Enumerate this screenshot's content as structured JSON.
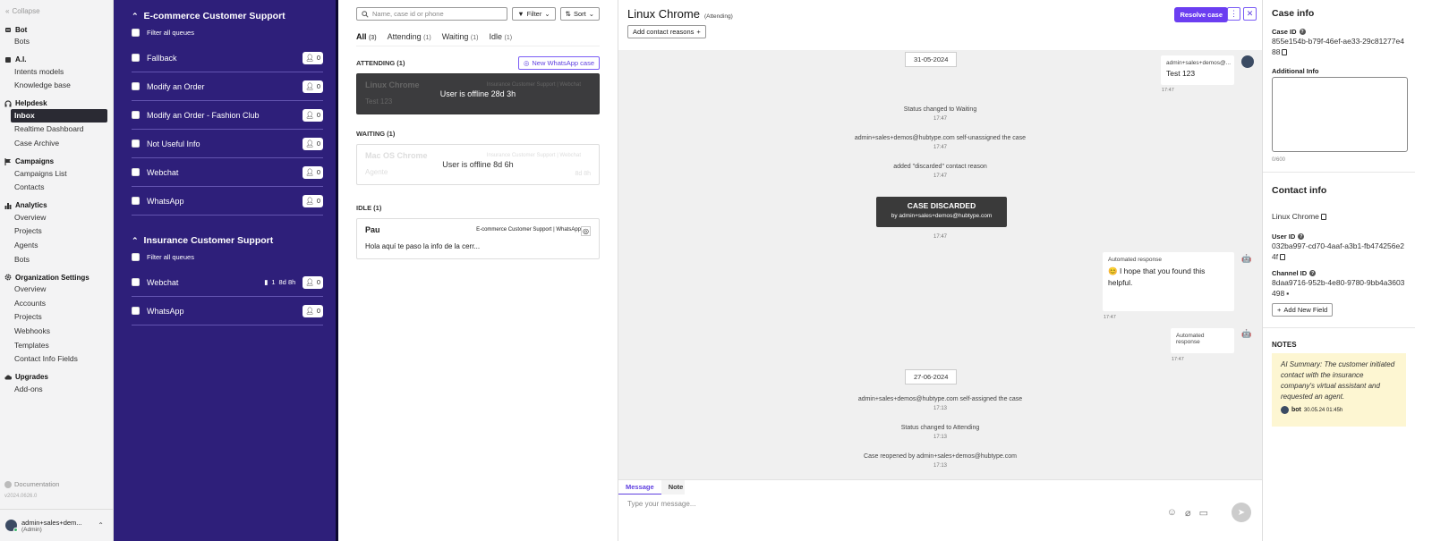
{
  "nav": {
    "collapse": "Collapse",
    "groups": [
      {
        "title": "Bot",
        "icon": "robot-icon",
        "items": [
          "Bots"
        ]
      },
      {
        "title": "A.I.",
        "icon": "ai-icon",
        "items": [
          "Intents models",
          "Knowledge base"
        ]
      },
      {
        "title": "Helpdesk",
        "icon": "headset-icon",
        "items": [
          "Inbox",
          "Realtime Dashboard",
          "Case Archive"
        ]
      },
      {
        "title": "Campaigns",
        "icon": "flag-icon",
        "items": [
          "Campaigns List",
          "Contacts"
        ]
      },
      {
        "title": "Analytics",
        "icon": "bar-chart-icon",
        "items": [
          "Overview",
          "Projects",
          "Agents",
          "Bots"
        ]
      },
      {
        "title": "Organization Settings",
        "icon": "gear-icon",
        "items": [
          "Overview",
          "Accounts",
          "Projects",
          "Webhooks",
          "Templates",
          "Contact Info Fields"
        ]
      },
      {
        "title": "Upgrades",
        "icon": "cloud-icon",
        "items": [
          "Add-ons"
        ]
      }
    ],
    "active_item": "Inbox",
    "documentation": "Documentation",
    "version": "v2024.0626.0",
    "user": {
      "name": "admin+sales+dem...",
      "role": "(Admin)"
    }
  },
  "queues": {
    "sections": [
      {
        "title": "E-commerce Customer Support",
        "filter_label": "Filter all queues",
        "rows": [
          {
            "name": "Fallback",
            "count": "0"
          },
          {
            "name": "Modify an Order",
            "count": "0"
          },
          {
            "name": "Modify an Order - Fashion Club",
            "count": "0"
          },
          {
            "name": "Not Useful Info",
            "count": "0"
          },
          {
            "name": "Webchat",
            "count": "0"
          },
          {
            "name": "WhatsApp",
            "count": "0"
          }
        ]
      },
      {
        "title": "Insurance Customer Support",
        "filter_label": "Filter all queues",
        "rows": [
          {
            "name": "Webchat",
            "count": "0",
            "waiting": "1",
            "wait_time": "8d 8h"
          },
          {
            "name": "WhatsApp",
            "count": "0"
          }
        ]
      }
    ]
  },
  "cases": {
    "search_placeholder": "Name, case id or phone",
    "filter": "Filter",
    "sort": "Sort",
    "tabs": [
      {
        "label": "All",
        "count": "(3)"
      },
      {
        "label": "Attending",
        "count": "(1)"
      },
      {
        "label": "Waiting",
        "count": "(1)"
      },
      {
        "label": "Idle",
        "count": "(1)"
      }
    ],
    "attending_header": "ATTENDING (1)",
    "new_whatsapp": "New WhatsApp case",
    "waiting_header": "WAITING (1)",
    "idle_header": "IDLE (1)",
    "attending_case": {
      "name": "Linux Chrome",
      "queue": "Insurance Customer Support | Webchat",
      "msg": "Test 123",
      "overlay": "User is offline 28d 3h"
    },
    "waiting_case": {
      "name": "Mac OS Chrome",
      "queue": "Insurance Customer Support | Webchat",
      "msg": "Agente",
      "time": "8d 8h",
      "overlay": "User is offline 8d 6h"
    },
    "idle_case": {
      "name": "Pau",
      "queue": "E-commerce Customer Support | WhatsApp",
      "msg": "Hola aquí te paso la info de la cerr..."
    }
  },
  "chat": {
    "title": "Linux Chrome",
    "status": "(Attending)",
    "add_reasons": "Add contact reasons",
    "resolve": "Resolve case",
    "date1": "31-05-2024",
    "user_msg": {
      "from": "admin+sales+demos@...",
      "text": "Test 123",
      "time": "17:47"
    },
    "sys1": {
      "text": "Status changed to Waiting",
      "time": "17:47"
    },
    "sys2": {
      "text": "admin+sales+demos@hubtype.com self-unassigned the case",
      "time": "17:47"
    },
    "sys3": {
      "text": "added \"discarded\" contact reason",
      "time": "17:47"
    },
    "discarded": {
      "title": "CASE DISCARDED",
      "by": "by admin+sales+demos@hubtype.com",
      "time": "17:47"
    },
    "auto1": {
      "from": "Automated response",
      "text": "😊 I hope that you found this helpful.",
      "time": "17:47"
    },
    "auto2": {
      "from": "Automated response",
      "time": "17:47"
    },
    "date2": "27-06-2024",
    "sys4": {
      "text": "admin+sales+demos@hubtype.com self-assigned the case",
      "time": "17:13"
    },
    "sys5": {
      "text": "Status changed to Attending",
      "time": "17:13"
    },
    "sys6": {
      "text": "Case reopened by admin+sales+demos@hubtype.com",
      "time": "17:13"
    },
    "compose_tabs": [
      "Message",
      "Note"
    ],
    "placeholder": "Type your message..."
  },
  "info": {
    "title": "Case info",
    "case_id_label": "Case ID",
    "case_id": "855e154b-b79f-46ef-ae33-29c81277e488",
    "additional_label": "Additional Info",
    "counter": "0/600",
    "contact_title": "Contact info",
    "contact_name": "Linux Chrome",
    "user_id_label": "User ID",
    "user_id": "032ba997-cd70-4aaf-a3b1-fb474256e24f",
    "channel_id_label": "Channel ID",
    "channel_id": "8daa9716-952b-4e80-9780-9bb4a3603498",
    "add_field": "Add New Field",
    "notes_title": "NOTES",
    "note_text": "AI Summary: The customer initiated contact with the insurance company's virtual assistant and requested an agent.",
    "note_author": "bot",
    "note_date": "30.05.24 01:45h"
  },
  "colors": {
    "primary": "#6b3ef1",
    "queue_bg": "#2e1f7a"
  }
}
